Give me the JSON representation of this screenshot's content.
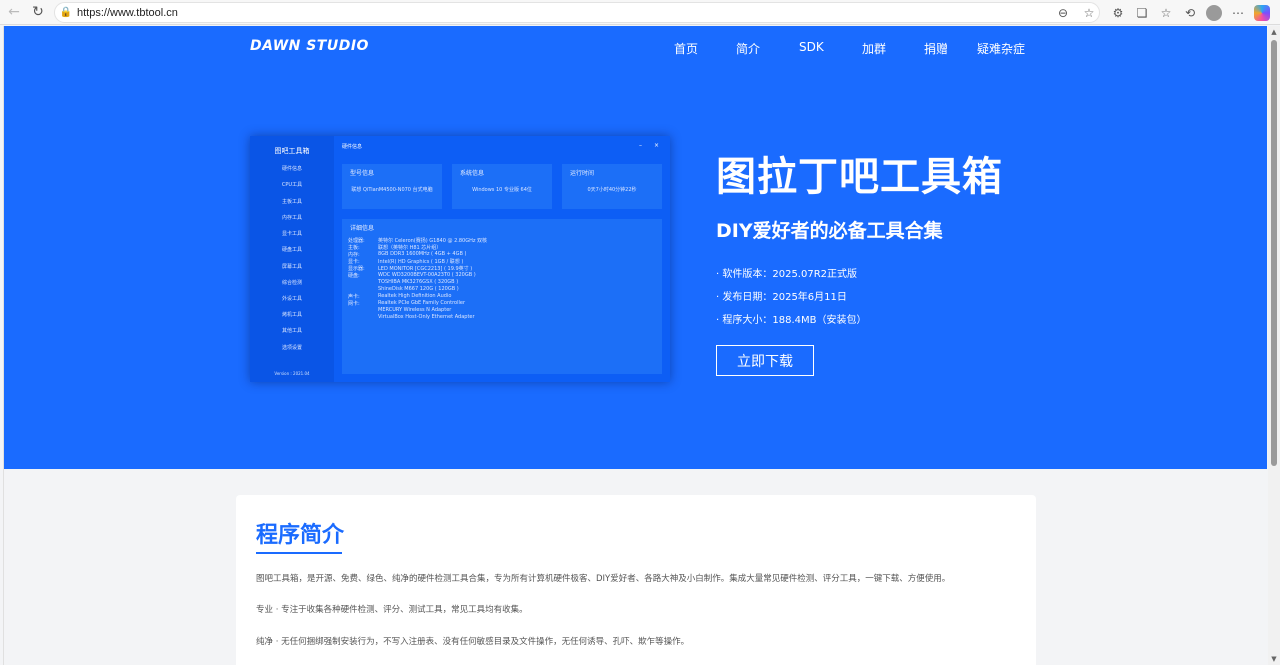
{
  "browser": {
    "url": "https://www.tbtool.cn"
  },
  "site": {
    "logo": "DAWN STUDIO",
    "nav": [
      "首页",
      "简介",
      "SDK",
      "加群",
      "捐赠",
      "疑难杂症"
    ]
  },
  "app_preview": {
    "sidebar_title": "图吧工具箱",
    "sidebar_items": [
      "硬件信息",
      "CPU工具",
      "主板工具",
      "内存工具",
      "显卡工具",
      "硬盘工具",
      "屏幕工具",
      "综合检测",
      "外设工具",
      "烤机工具",
      "其他工具",
      "选项设置"
    ],
    "version": "Version : 2021.04",
    "window_title": "硬件信息",
    "cards": [
      {
        "title": "型号信息",
        "value": "联想 QiTianM4500-N070 台式电脑"
      },
      {
        "title": "系统信息",
        "value": "Windows 10 专业版 64位"
      },
      {
        "title": "运行时间",
        "value": "0天7小时40分钟22秒"
      }
    ],
    "detail_title": "详细信息",
    "details": [
      {
        "label": "处理器:",
        "value": "英特尔 Celeron(赛扬) G1840 @ 2.80GHz 双核"
      },
      {
        "label": "主板:",
        "value": "联想（英特尔 H81 芯片组）"
      },
      {
        "label": "内存:",
        "value": "8GB DDR3 1600MHz ( 4GB + 4GB )"
      },
      {
        "label": "显卡:",
        "value": "Intel(R) HD Graphics ( 1GB / 联想 )"
      },
      {
        "label": "显示器:",
        "value": "LED MONITOR [CGC2213] ( 19.9英寸 )"
      },
      {
        "label": "硬盘:",
        "value": "WDC WD3200BEVT-00A23T0 ( 320GB )"
      },
      {
        "label": "",
        "value": "TOSHIBA MK3276GSX ( 320GB )"
      },
      {
        "label": "",
        "value": "ShineDisk M667 120G ( 120GB )"
      },
      {
        "label": "声卡:",
        "value": "Realtek High Definition Audio"
      },
      {
        "label": "网卡:",
        "value": "Realtek PCIe GbE Family Controller"
      },
      {
        "label": "",
        "value": "MERCURY Wireless N Adapter"
      },
      {
        "label": "",
        "value": "VirtualBox Host-Only Ethernet Adapter"
      }
    ]
  },
  "hero": {
    "title": "图拉丁吧工具箱",
    "subtitle": "DIY爱好者的必备工具合集",
    "version": "· 软件版本：2025.07R2正式版",
    "date": "· 发布日期：2025年6月11日",
    "size": "· 程序大小：188.4MB（安装包）",
    "download": "立即下载"
  },
  "intro": {
    "heading": "程序简介",
    "paragraphs": [
      "图吧工具箱，是开源、免费、绿色、纯净的硬件检测工具合集，专为所有计算机硬件极客、DIY爱好者、各路大神及小白制作。集成大量常见硬件检测、评分工具，一键下载、方便使用。",
      "专业 · 专注于收集各种硬件检测、评分、测试工具，常见工具均有收集。",
      "纯净 · 无任何捆绑强制安装行为，不写入注册表、没有任何敏感目录及文件操作，无任何诱导、孔吓、欺乍等操作。"
    ]
  },
  "colors": {
    "brand": "#1a6bff",
    "page_bg": "#f3f4f6"
  }
}
